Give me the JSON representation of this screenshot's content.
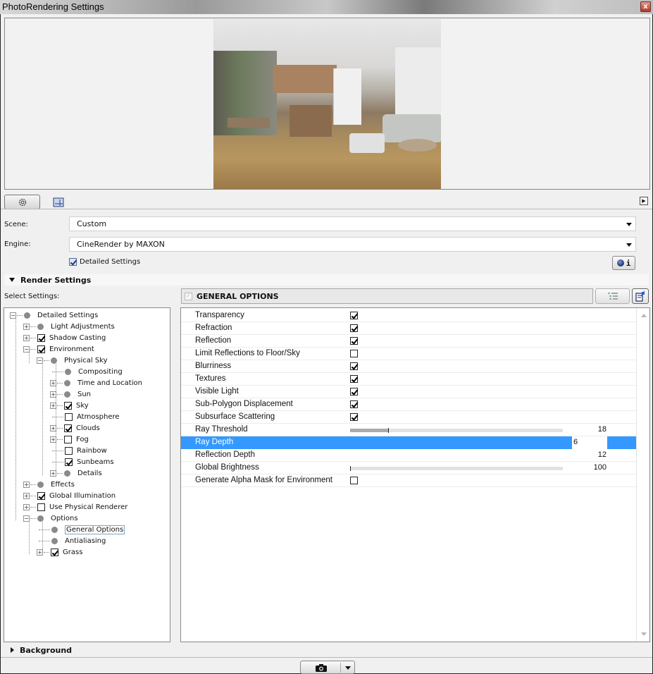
{
  "window": {
    "title": "PhotoRendering Settings",
    "close_icon": "close-icon"
  },
  "preview": {
    "description": "Rendered interior preview: open-plan kitchen, dining and living room with wooden floor"
  },
  "toolbar": {
    "settings_tab_icon": "gear-icon",
    "size_tab_icon": "image-size-icon",
    "expand_icon": "triangle-right-icon"
  },
  "scene": {
    "label": "Scene:",
    "value": "Custom"
  },
  "engine": {
    "label": "Engine:",
    "value": "CineRender by MAXON"
  },
  "detailed_settings": {
    "label": "Detailed Settings",
    "checked": true
  },
  "render_settings": {
    "title": "Render Settings",
    "expanded": true,
    "select_label": "Select Settings:"
  },
  "tree": [
    {
      "label": "Detailed Settings",
      "level": 0,
      "toggle": "-",
      "mark": "bullet"
    },
    {
      "label": "Light Adjustments",
      "level": 1,
      "toggle": "+",
      "mark": "bullet"
    },
    {
      "label": "Shadow Casting",
      "level": 1,
      "toggle": "+",
      "mark": "checked"
    },
    {
      "label": "Environment",
      "level": 1,
      "toggle": "-",
      "mark": "checked"
    },
    {
      "label": "Physical Sky",
      "level": 2,
      "toggle": "-",
      "mark": "bullet"
    },
    {
      "label": "Compositing",
      "level": 3,
      "toggle": "",
      "mark": "bullet"
    },
    {
      "label": "Time and Location",
      "level": 3,
      "toggle": "+",
      "mark": "bullet"
    },
    {
      "label": "Sun",
      "level": 3,
      "toggle": "+",
      "mark": "bullet"
    },
    {
      "label": "Sky",
      "level": 3,
      "toggle": "+",
      "mark": "checked"
    },
    {
      "label": "Atmosphere",
      "level": 3,
      "toggle": "",
      "mark": "unchecked"
    },
    {
      "label": "Clouds",
      "level": 3,
      "toggle": "+",
      "mark": "checked"
    },
    {
      "label": "Fog",
      "level": 3,
      "toggle": "+",
      "mark": "unchecked"
    },
    {
      "label": "Rainbow",
      "level": 3,
      "toggle": "",
      "mark": "unchecked"
    },
    {
      "label": "Sunbeams",
      "level": 3,
      "toggle": "",
      "mark": "checked"
    },
    {
      "label": "Details",
      "level": 3,
      "toggle": "+",
      "mark": "bullet"
    },
    {
      "label": "Effects",
      "level": 1,
      "toggle": "+",
      "mark": "bullet"
    },
    {
      "label": "Global Illumination",
      "level": 1,
      "toggle": "+",
      "mark": "checked"
    },
    {
      "label": "Use Physical Renderer",
      "level": 1,
      "toggle": "+",
      "mark": "unchecked"
    },
    {
      "label": "Options",
      "level": 1,
      "toggle": "-",
      "mark": "bullet"
    },
    {
      "label": "General Options",
      "level": 2,
      "toggle": "",
      "mark": "bullet",
      "selected": true
    },
    {
      "label": "Antialiasing",
      "level": 2,
      "toggle": "",
      "mark": "bullet"
    },
    {
      "label": "Grass",
      "level": 2,
      "toggle": "+",
      "mark": "checked"
    }
  ],
  "general_options": {
    "title": "GENERAL OPTIONS",
    "list_view_icon": "tree-list-icon",
    "export_icon": "export-settings-icon",
    "rows": [
      {
        "label": "Transparency",
        "type": "checkbox",
        "checked": true
      },
      {
        "label": "Refraction",
        "type": "checkbox",
        "checked": true
      },
      {
        "label": "Reflection",
        "type": "checkbox",
        "checked": true
      },
      {
        "label": "Limit Reflections to Floor/Sky",
        "type": "checkbox",
        "checked": false
      },
      {
        "label": "Blurriness",
        "type": "checkbox",
        "checked": true
      },
      {
        "label": "Textures",
        "type": "checkbox",
        "checked": true
      },
      {
        "label": "Visible Light",
        "type": "checkbox",
        "checked": true
      },
      {
        "label": "Sub-Polygon Displacement",
        "type": "checkbox",
        "checked": true
      },
      {
        "label": "Subsurface Scattering",
        "type": "checkbox",
        "checked": true
      },
      {
        "label": "Ray Threshold",
        "type": "slider",
        "value": "18",
        "fraction": 0.18
      },
      {
        "label": "Ray Depth",
        "type": "edit",
        "value": "6",
        "selected": true
      },
      {
        "label": "Reflection Depth",
        "type": "number",
        "value": "12"
      },
      {
        "label": "Global Brightness",
        "type": "slider",
        "value": "100",
        "fraction": 0.0
      },
      {
        "label": "Generate Alpha Mask for Environment",
        "type": "checkbox",
        "checked": false
      }
    ]
  },
  "background": {
    "title": "Background",
    "expanded": false
  },
  "footer": {
    "render_icon": "camera-icon",
    "dropdown_icon": "chevron-down-icon"
  },
  "colors": {
    "selection": "#3399ff",
    "close_button": "#c0483a"
  }
}
